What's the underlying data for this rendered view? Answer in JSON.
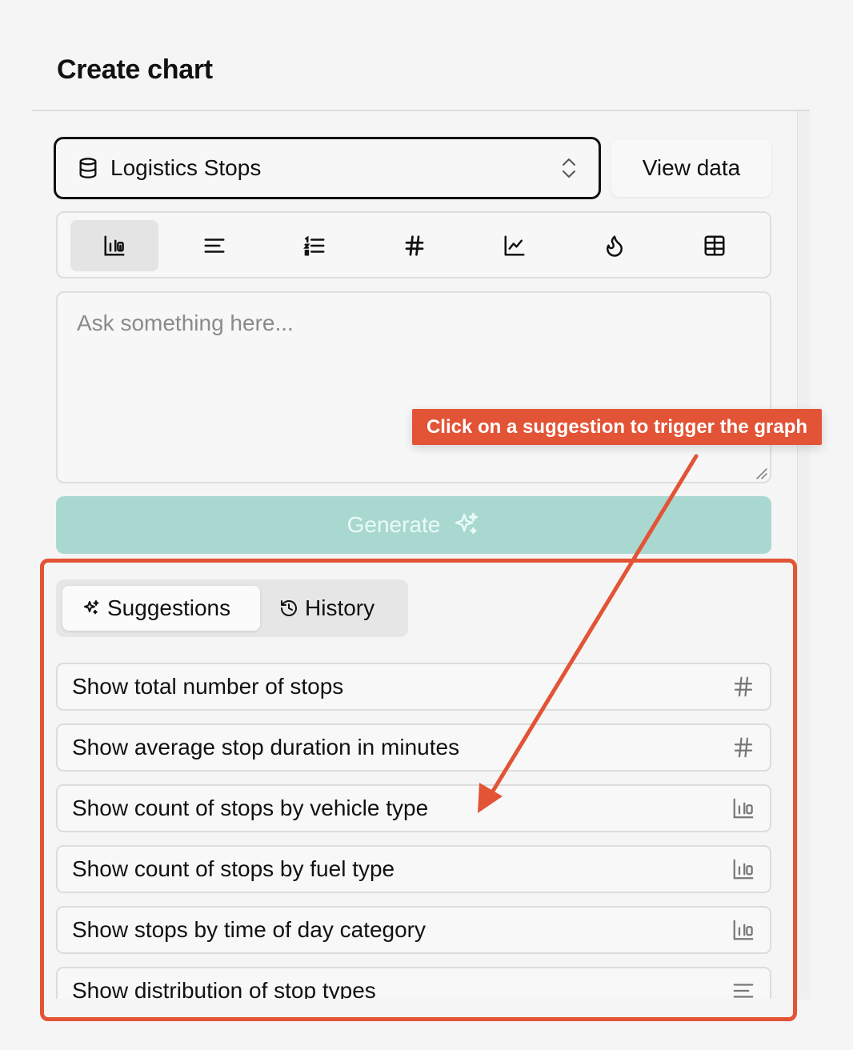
{
  "header": {
    "title": "Create chart"
  },
  "dataset": {
    "label": "Logistics Stops",
    "icon": "database-icon"
  },
  "view_data_label": "View data",
  "chart_types": [
    {
      "name": "bar-chart-icon",
      "active": true
    },
    {
      "name": "align-left-icon",
      "active": false
    },
    {
      "name": "numbered-list-icon",
      "active": false
    },
    {
      "name": "hash-icon",
      "active": false
    },
    {
      "name": "line-chart-icon",
      "active": false
    },
    {
      "name": "flame-icon",
      "active": false
    },
    {
      "name": "table-icon",
      "active": false
    }
  ],
  "prompt": {
    "placeholder": "Ask something here...",
    "value": ""
  },
  "generate_label": "Generate",
  "tabs": [
    {
      "label": "Suggestions",
      "icon": "sparkles-icon",
      "active": true
    },
    {
      "label": "History",
      "icon": "history-icon",
      "active": false
    }
  ],
  "suggestions": [
    {
      "text": "Show total number of stops",
      "icon": "hash-icon"
    },
    {
      "text": "Show average stop duration in minutes",
      "icon": "hash-icon"
    },
    {
      "text": "Show count of stops by vehicle type",
      "icon": "bar-chart-icon"
    },
    {
      "text": "Show count of stops by fuel type",
      "icon": "bar-chart-icon"
    },
    {
      "text": "Show stops by time of day category",
      "icon": "bar-chart-icon"
    },
    {
      "text": "Show distribution of stop types",
      "icon": "align-left-icon"
    }
  ],
  "annotation": {
    "callout": "Click on a suggestion to trigger the graph",
    "color": "#e35336"
  },
  "colors": {
    "generate_bg": "#a8d8d0",
    "accent": "#e35336"
  }
}
